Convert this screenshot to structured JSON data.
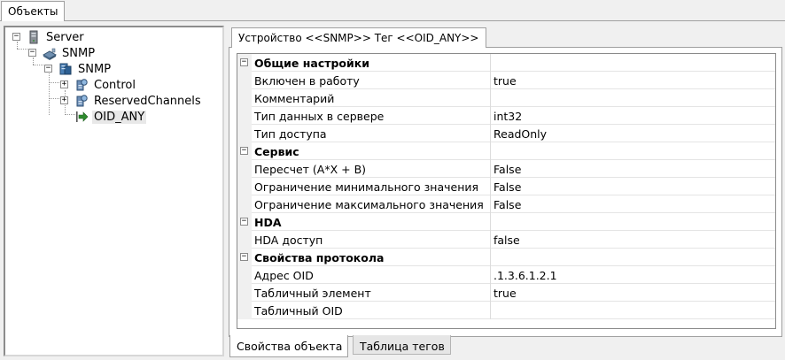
{
  "top_tab": {
    "label": "Объекты"
  },
  "tree": {
    "nodes": [
      {
        "label": "Server",
        "icon": "server-icon",
        "expander": "−"
      },
      {
        "label": "SNMP",
        "icon": "network-device-icon",
        "expander": "−"
      },
      {
        "label": "SNMP",
        "icon": "device-blue-icon",
        "expander": "−"
      },
      {
        "label": "Control",
        "icon": "device-tag-icon",
        "expander": "+"
      },
      {
        "label": "ReservedChannels",
        "icon": "device-tag-icon",
        "expander": "+"
      },
      {
        "label": "OID_ANY",
        "icon": "green-arrow-tag-icon",
        "selected": true
      }
    ]
  },
  "inner_tab": {
    "label": "Устройство <<SNMP>> Тег  <<OID_ANY>>"
  },
  "properties": {
    "collapse_glyph": "−",
    "rows": [
      {
        "type": "category",
        "name": "Общие настройки",
        "value": ""
      },
      {
        "type": "prop",
        "name": "Включен в работу",
        "value": "true"
      },
      {
        "type": "prop",
        "name": "Комментарий",
        "value": ""
      },
      {
        "type": "prop",
        "name": "Тип данных в сервере",
        "value": "int32"
      },
      {
        "type": "prop",
        "name": "Тип доступа",
        "value": "ReadOnly"
      },
      {
        "type": "category",
        "name": "Сервис",
        "value": ""
      },
      {
        "type": "prop",
        "name": "Пересчет (A*X + B)",
        "value": "False"
      },
      {
        "type": "prop",
        "name": "Ограничение минимального значения",
        "value": "False"
      },
      {
        "type": "prop",
        "name": "Ограничение максимального значения",
        "value": "False"
      },
      {
        "type": "category",
        "name": "HDA",
        "value": ""
      },
      {
        "type": "prop",
        "name": "HDA доступ",
        "value": "false"
      },
      {
        "type": "category",
        "name": "Свойства протокола",
        "value": ""
      },
      {
        "type": "prop",
        "name": "Адрес OID",
        "value": ".1.3.6.1.2.1"
      },
      {
        "type": "prop",
        "name": "Табличный элемент",
        "value": "true"
      },
      {
        "type": "prop",
        "name": "Табличный OID",
        "value": ""
      }
    ]
  },
  "bottom_tabs": [
    {
      "label": "Свойства объекта",
      "active": true
    },
    {
      "label": "Таблица тегов",
      "active": false
    }
  ],
  "colors": {
    "selection": "#e8e8e8",
    "panel_bg": "#f0f0f0",
    "border": "#a0a0a0",
    "arrow_green": "#2e8b2e",
    "device_blue": "#4a7fb5"
  }
}
